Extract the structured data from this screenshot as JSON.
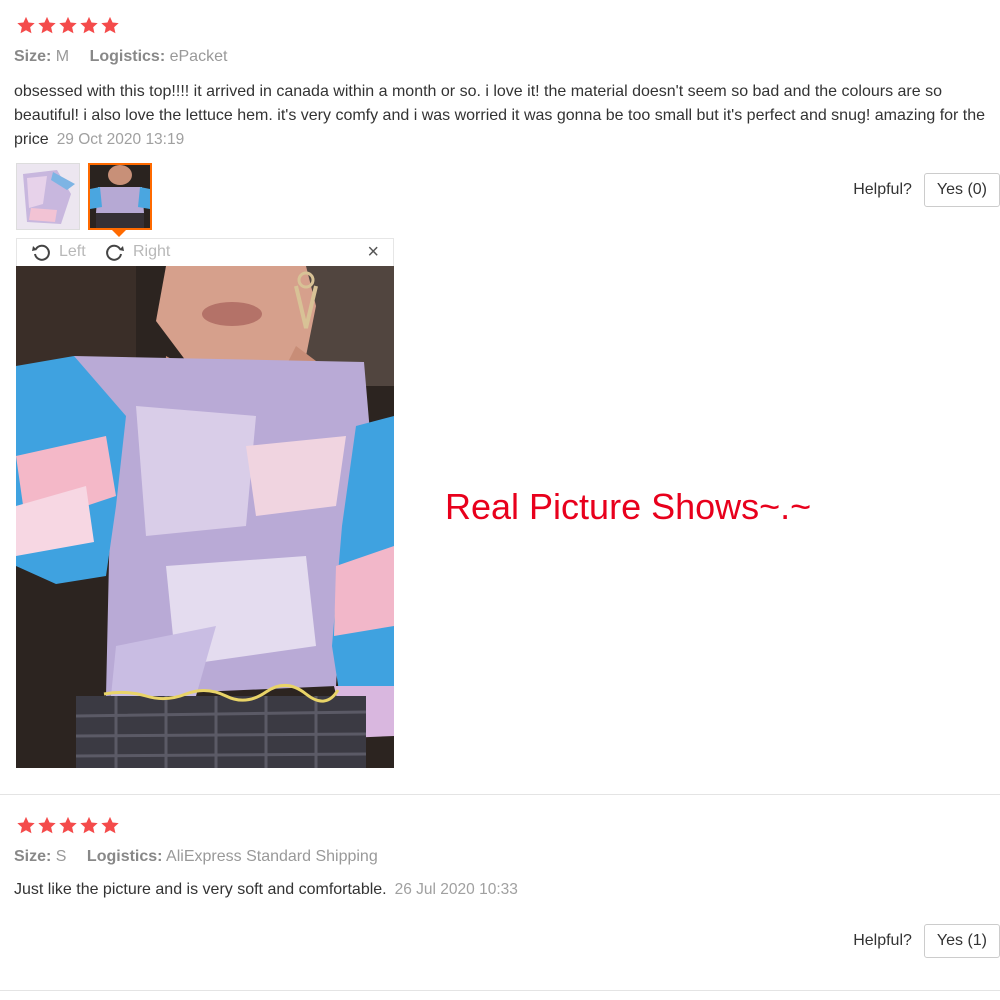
{
  "reviews": [
    {
      "rating": 5,
      "size_label": "Size:",
      "size_value": "M",
      "logistics_label": "Logistics:",
      "logistics_value": "ePacket",
      "text": "obsessed with this top!!!! it arrived in canada within a month or so. i love it! the material doesn't seem so bad and the colours are so beautiful! i also love the lettuce hem. it's very comfy and i was worried it was gonna be too small but it's perfect and snug! amazing for the price",
      "date": "29 Oct 2020 13:19",
      "helpful_label": "Helpful?",
      "yes_label": "Yes (0)"
    },
    {
      "rating": 5,
      "size_label": "Size:",
      "size_value": "S",
      "logistics_label": "Logistics:",
      "logistics_value": "AliExpress Standard Shipping",
      "text": "Just like the picture and is very soft and comfortable.",
      "date": "26 Jul 2020 10:33",
      "helpful_label": "Helpful?",
      "yes_label": "Yes (1)"
    }
  ],
  "viewer": {
    "rotate_left_label": "Left",
    "rotate_right_label": "Right",
    "close_label": "×",
    "icons": [
      "rotate-left-icon",
      "rotate-right-icon",
      "close-icon"
    ]
  },
  "caption": "Real Picture Shows~.~",
  "colors": {
    "star": "#f44b4b",
    "accent": "#ff6a00",
    "caption": "#e8001c",
    "muted_text": "#999999"
  }
}
